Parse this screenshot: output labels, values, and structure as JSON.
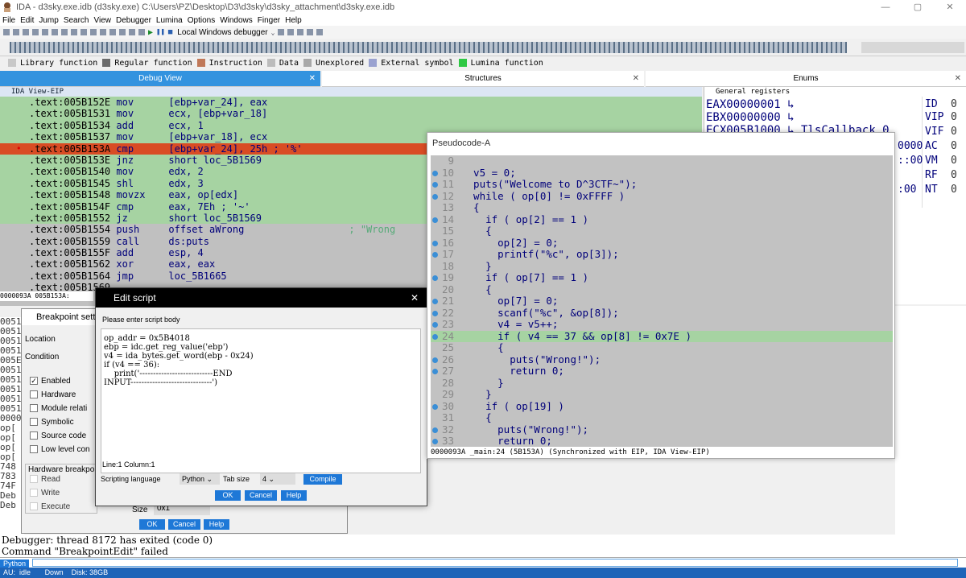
{
  "window": {
    "title": "IDA - d3sky.exe.idb (d3sky.exe) C:\\Users\\PZ\\Desktop\\D3\\d3sky\\d3sky_attachment\\d3sky.exe.idb"
  },
  "menu": [
    "File",
    "Edit",
    "Jump",
    "Search",
    "View",
    "Debugger",
    "Lumina",
    "Options",
    "Windows",
    "Finger",
    "Help"
  ],
  "toolbar": {
    "debugger": "Local Windows debugger"
  },
  "legend": [
    {
      "label": "Library function",
      "color": "#c8c8c8"
    },
    {
      "label": "Regular function",
      "color": "#6b6b6b"
    },
    {
      "label": "Instruction",
      "color": "#c07858"
    },
    {
      "label": "Data",
      "color": "#bcbcbc"
    },
    {
      "label": "Unexplored",
      "color": "#a8a8a8"
    },
    {
      "label": "External symbol",
      "color": "#9aa2d0"
    },
    {
      "label": "Lumina function",
      "color": "#2fc844"
    }
  ],
  "tabs": {
    "debug": "Debug View",
    "structures": "Structures",
    "enums": "Enums"
  },
  "ida_view": {
    "header": "IDA View-EIP",
    "status": "0000093A 005B153A:",
    "lines": [
      {
        "addr": ".text:005B152E",
        "mn": "mov",
        "op": "[ebp+var_24], eax",
        "cm": "",
        "hl": "green"
      },
      {
        "addr": ".text:005B1531",
        "mn": "mov",
        "op": "ecx, [ebp+var_18]",
        "cm": "",
        "hl": "green"
      },
      {
        "addr": ".text:005B1534",
        "mn": "add",
        "op": "ecx, 1",
        "cm": "",
        "hl": "green"
      },
      {
        "addr": ".text:005B1537",
        "mn": "mov",
        "op": "[ebp+var_18], ecx",
        "cm": "",
        "hl": "green"
      },
      {
        "addr": ".text:005B153A",
        "mn": "cmp",
        "op": "[ebp+var_24], 25h ; '%'",
        "cm": "",
        "hl": "red"
      },
      {
        "addr": ".text:005B153E",
        "mn": "jnz",
        "op": "short loc_5B1569",
        "cm": "",
        "hl": "green"
      },
      {
        "addr": ".text:005B1540",
        "mn": "mov",
        "op": "edx, 2",
        "cm": "",
        "hl": "green"
      },
      {
        "addr": ".text:005B1545",
        "mn": "shl",
        "op": "edx, 3",
        "cm": "",
        "hl": "green"
      },
      {
        "addr": ".text:005B1548",
        "mn": "movzx",
        "op": "eax, op[edx]",
        "cm": "",
        "hl": "green"
      },
      {
        "addr": ".text:005B154F",
        "mn": "cmp",
        "op": "eax, 7Eh ; '~'",
        "cm": "",
        "hl": "green"
      },
      {
        "addr": ".text:005B1552",
        "mn": "jz",
        "op": "short loc_5B1569",
        "cm": "",
        "hl": "green"
      },
      {
        "addr": ".text:005B1554",
        "mn": "push",
        "op": "offset aWrong",
        "cm": "; \"Wrong",
        "hl": ""
      },
      {
        "addr": ".text:005B1559",
        "mn": "call",
        "op": "ds:puts",
        "cm": "",
        "hl": ""
      },
      {
        "addr": ".text:005B155F",
        "mn": "add",
        "op": "esp, 4",
        "cm": "",
        "hl": ""
      },
      {
        "addr": ".text:005B1562",
        "mn": "xor",
        "op": "eax, eax",
        "cm": "",
        "hl": ""
      },
      {
        "addr": ".text:005B1564",
        "mn": "jmp",
        "op": "loc_5B1665",
        "cm": "",
        "hl": ""
      },
      {
        "addr": ".text:005B1569",
        "mn": "",
        "op": "",
        "cm": "",
        "hl": ""
      }
    ]
  },
  "registers": {
    "header": "General registers",
    "regs": [
      {
        "name": "EAX",
        "val": "00000001"
      },
      {
        "name": "EBX",
        "val": "00000000"
      },
      {
        "name": "ECX",
        "val": "005B1000",
        "ref": "TlsCallback_0"
      }
    ],
    "flags": [
      {
        "n": "ID",
        "v": "0"
      },
      {
        "n": "VIP",
        "v": "0"
      },
      {
        "n": "VIF",
        "v": "0"
      },
      {
        "n": "AC",
        "v": "0"
      },
      {
        "n": "VM",
        "v": "0"
      },
      {
        "n": "RF",
        "v": "0"
      },
      {
        "n": "NT",
        "v": "0"
      }
    ],
    "partial": [
      "0000",
      "::00",
      "",
      ":00"
    ]
  },
  "pseudo": {
    "title": "Pseudocode-A",
    "status": "0000093A _main:24 (5B153A) (Synchronized with EIP, IDA View-EIP)",
    "lines": [
      {
        "n": "9",
        "t": "",
        "dot": false
      },
      {
        "n": "10",
        "t": "  v5 = 0;",
        "dot": true
      },
      {
        "n": "11",
        "t": "  puts(\"Welcome to D^3CTF~\");",
        "dot": true
      },
      {
        "n": "12",
        "t": "  while ( op[0] != 0xFFFF )",
        "dot": true
      },
      {
        "n": "13",
        "t": "  {",
        "dot": false
      },
      {
        "n": "14",
        "t": "    if ( op[2] == 1 )",
        "dot": true
      },
      {
        "n": "15",
        "t": "    {",
        "dot": false
      },
      {
        "n": "16",
        "t": "      op[2] = 0;",
        "dot": true
      },
      {
        "n": "17",
        "t": "      printf(\"%c\", op[3]);",
        "dot": true
      },
      {
        "n": "18",
        "t": "    }",
        "dot": false
      },
      {
        "n": "19",
        "t": "    if ( op[7] == 1 )",
        "dot": true
      },
      {
        "n": "20",
        "t": "    {",
        "dot": false
      },
      {
        "n": "21",
        "t": "      op[7] = 0;",
        "dot": true
      },
      {
        "n": "22",
        "t": "      scanf(\"%c\", &op[8]);",
        "dot": true
      },
      {
        "n": "23",
        "t": "      v4 = v5++;",
        "dot": true
      },
      {
        "n": "24",
        "t": "      if ( v4 == 37 && op[8] != 0x7E )",
        "dot": true,
        "hl": true
      },
      {
        "n": "25",
        "t": "      {",
        "dot": false
      },
      {
        "n": "26",
        "t": "        puts(\"Wrong!\");",
        "dot": true
      },
      {
        "n": "27",
        "t": "        return 0;",
        "dot": true
      },
      {
        "n": "28",
        "t": "      }",
        "dot": false
      },
      {
        "n": "29",
        "t": "    }",
        "dot": false
      },
      {
        "n": "30",
        "t": "    if ( op[19] )",
        "dot": true
      },
      {
        "n": "31",
        "t": "    {",
        "dot": false
      },
      {
        "n": "32",
        "t": "      puts(\"Wrong!\");",
        "dot": true
      },
      {
        "n": "33",
        "t": "      return 0;",
        "dot": true
      }
    ]
  },
  "bp": {
    "title": "Breakpoint setti",
    "location": "Location",
    "condition": "Condition",
    "checks": [
      {
        "l": "Enabled",
        "c": true
      },
      {
        "l": "Hardware",
        "c": false
      },
      {
        "l": "Module relati",
        "c": false
      },
      {
        "l": "Symbolic",
        "c": false
      },
      {
        "l": "Source code",
        "c": false
      },
      {
        "l": "Low level con",
        "c": false
      }
    ],
    "hw_group": "Hardware breakpo",
    "hw": [
      "Read",
      "Write",
      "Execute"
    ],
    "size_label": "Size",
    "size_val": "0x1",
    "ok": "OK",
    "cancel": "Cancel",
    "help": "Help"
  },
  "es": {
    "title": "Edit script",
    "prompt": "Please enter script body",
    "code": [
      "op_addr = 0x5B4018",
      "ebp = idc.get_reg_value('ebp')",
      "v4 = ida_bytes.get_word(ebp - 0x24)",
      "if (v4 == 36):",
      "    print('---------------------------END",
      "INPUT------------------------------')"
    ],
    "pos": "Line:1  Column:1",
    "lang_label": "Scripting language",
    "lang": "Python",
    "tab_label": "Tab size",
    "tab": "4",
    "compile": "Compile",
    "ok": "OK",
    "cancel": "Cancel",
    "help": "Help"
  },
  "left_code": [
    "0051",
    "0051",
    "0051",
    "0051",
    "005E",
    "0051",
    "0051",
    "0051",
    "0051",
    "0051",
    "0000",
    "op[",
    "op[",
    "op[",
    "op[",
    "748",
    "783",
    "74F",
    "Deb",
    "Deb"
  ],
  "output": [
    "Debugger: thread 8172 has exited (code 0)",
    "Command \"BreakpointEdit\" failed"
  ],
  "python_tab": "Python",
  "status": {
    "au": "AU:",
    "state": "idle",
    "down": "Down",
    "disk": "Disk: 38GB"
  }
}
